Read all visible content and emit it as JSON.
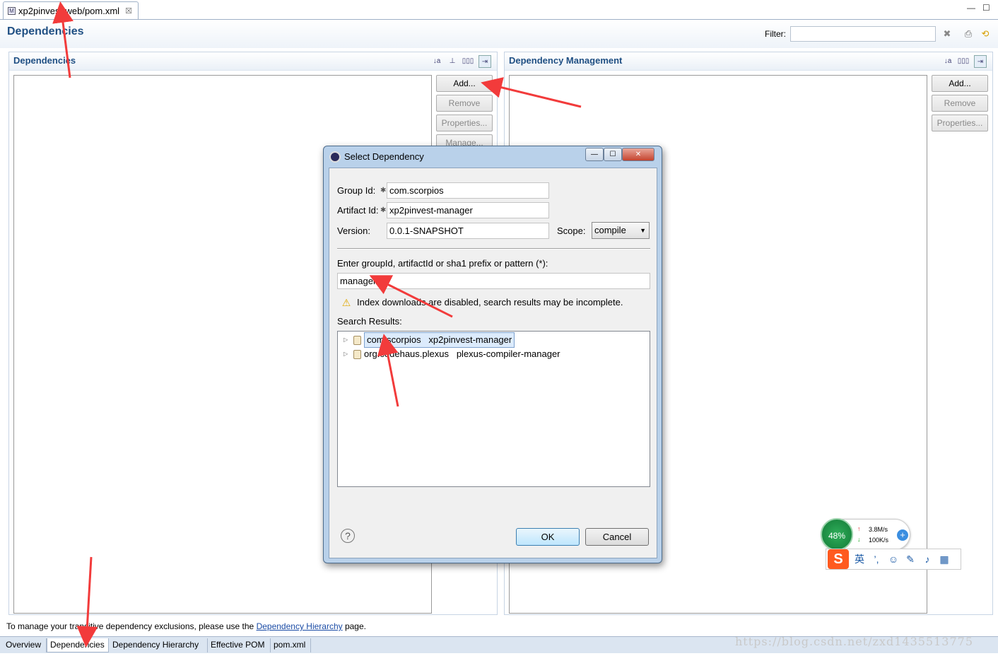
{
  "editor_tab": {
    "label": "xp2pinvest-web/pom.xml",
    "close": "☒"
  },
  "window_controls": {
    "minimize": "—",
    "maximize": "☐"
  },
  "page": {
    "title": "Dependencies",
    "filter_label": "Filter:",
    "filter_value": ""
  },
  "dependencies": {
    "title": "Dependencies",
    "buttons": {
      "add": "Add...",
      "remove": "Remove",
      "properties": "Properties...",
      "manage": "Manage..."
    }
  },
  "management": {
    "title": "Dependency Management",
    "buttons": {
      "add": "Add...",
      "remove": "Remove",
      "properties": "Properties..."
    }
  },
  "info": {
    "prefix": "To manage your transitive dependency exclusions, please use the ",
    "link": "Dependency Hierarchy",
    "suffix": " page."
  },
  "bottom_tabs": [
    "Overview",
    "Dependencies",
    "Dependency Hierarchy",
    "Effective POM",
    "pom.xml"
  ],
  "watermark": "https://blog.csdn.net/zxd1435513775",
  "dialog": {
    "title": "Select Dependency",
    "group_label": "Group Id:",
    "group_value": "com.scorpios",
    "artifact_label": "Artifact Id:",
    "artifact_value": "xp2pinvest-manager",
    "version_label": "Version:",
    "version_value": "0.0.1-SNAPSHOT",
    "scope_label": "Scope:",
    "scope_value": "compile",
    "search_label": "Enter groupId, artifactId or sha1 prefix or pattern (*):",
    "search_value": "manager",
    "warning": "Index downloads are disabled, search results may be incomplete.",
    "results_label": "Search Results:",
    "results": [
      {
        "group": "com.scorpios",
        "artifact": "xp2pinvest-manager"
      },
      {
        "group": "org.codehaus.plexus",
        "artifact": "plexus-compiler-manager"
      }
    ],
    "ok": "OK",
    "cancel": "Cancel",
    "help": "?"
  },
  "net_widget": {
    "percent": "48%",
    "up": "3.8M/s",
    "down": "100K/s"
  },
  "ime": {
    "logo": "S",
    "lang": "英"
  },
  "colors": {
    "accent": "#1f4f83",
    "arrow": "#f23b3b",
    "link": "#1a4ba5"
  }
}
